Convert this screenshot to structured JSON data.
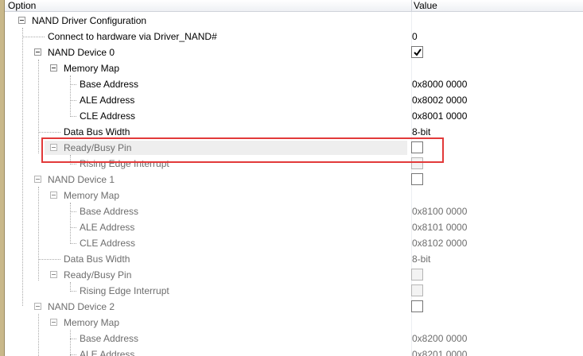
{
  "header": {
    "option": "Option",
    "value": "Value"
  },
  "tree": {
    "root": "NAND Driver Configuration",
    "connect": {
      "label": "Connect to hardware via Driver_NAND#",
      "value": "0"
    },
    "devices": [
      {
        "label": "NAND Device 0",
        "checked": true,
        "memory_map": "Memory Map",
        "base": {
          "label": "Base Address",
          "value": "0x8000 0000"
        },
        "ale": {
          "label": "ALE Address",
          "value": "0x8002 0000"
        },
        "cle": {
          "label": "CLE Address",
          "value": "0x8001 0000"
        },
        "bus": {
          "label": "Data Bus Width",
          "value": "8-bit"
        },
        "ready": {
          "label": "Ready/Busy Pin",
          "checked": false
        },
        "rising": {
          "label": "Rising Edge Interrupt",
          "checked": false
        }
      },
      {
        "label": "NAND Device 1",
        "checked": false,
        "memory_map": "Memory Map",
        "base": {
          "label": "Base Address",
          "value": "0x8100 0000"
        },
        "ale": {
          "label": "ALE Address",
          "value": "0x8101 0000"
        },
        "cle": {
          "label": "CLE Address",
          "value": "0x8102 0000"
        },
        "bus": {
          "label": "Data Bus Width",
          "value": "8-bit"
        },
        "ready": {
          "label": "Ready/Busy Pin",
          "checked": false
        },
        "rising": {
          "label": "Rising Edge Interrupt",
          "checked": false
        }
      },
      {
        "label": "NAND Device 2",
        "checked": false,
        "memory_map": "Memory Map",
        "base": {
          "label": "Base Address",
          "value": "0x8200 0000"
        },
        "ale": {
          "label": "ALE Address",
          "value": "0x8201 0000"
        }
      }
    ]
  },
  "colors": {
    "highlight": "#e23a3a",
    "selected_row": "#eeeeee",
    "disabled_text": "#6d6d6d"
  }
}
